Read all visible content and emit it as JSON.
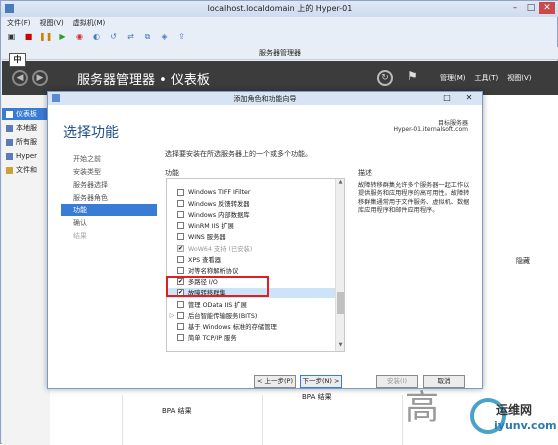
{
  "vm": {
    "title": "localhost.localdomain 上的 Hyper-01",
    "menu": [
      "文件(F)",
      "视图(V)",
      "虚拟机(M)"
    ]
  },
  "server_manager": {
    "window_title": "服务器管理器",
    "ime_indicator": "中",
    "breadcrumb": "服务器管理器 • 仪表板",
    "menu": [
      "管理(M)",
      "工具(T)",
      "视图(V)"
    ],
    "nav": [
      "仪表板",
      "本地服",
      "所有服",
      "Hyper",
      "文件和"
    ],
    "bpa_results_1": "BPA 结果",
    "bpa_results_2": "BPA 结果",
    "hide_label": "隐藏"
  },
  "wizard": {
    "title": "添加角色和功能向导",
    "heading": "选择功能",
    "destination_label": "目标服务器",
    "destination_server": "Hyper-01.iternalsoft.com",
    "instruction": "选择要安装在所选服务器上的一个或多个功能。",
    "features_header": "功能",
    "description_header": "描述",
    "description": "故障转移群集允许多个服务器一起工作以提供服务和应用程序的高可用性。故障转移群集通常用于文件服务、虚拟机、数据库应用程序和邮件应用程序。",
    "steps": [
      {
        "label": "开始之前",
        "state": "normal"
      },
      {
        "label": "安装类型",
        "state": "normal"
      },
      {
        "label": "服务器选择",
        "state": "normal"
      },
      {
        "label": "服务器角色",
        "state": "normal"
      },
      {
        "label": "功能",
        "state": "active"
      },
      {
        "label": "确认",
        "state": "normal"
      },
      {
        "label": "结果",
        "state": "disabled"
      }
    ],
    "features": [
      {
        "label": "Windows TIFF IFilter",
        "checked": false,
        "expandable": false,
        "disabled": false
      },
      {
        "label": "Windows 反馈转发器",
        "checked": false,
        "expandable": false,
        "disabled": false
      },
      {
        "label": "Windows 内部数据库",
        "checked": false,
        "expandable": false,
        "disabled": false
      },
      {
        "label": "WinRM IIS 扩展",
        "checked": false,
        "expandable": false,
        "disabled": false
      },
      {
        "label": "WINS 服务器",
        "checked": false,
        "expandable": false,
        "disabled": false
      },
      {
        "label": "WoW64 支持 (已安装)",
        "checked": true,
        "expandable": false,
        "disabled": true
      },
      {
        "label": "XPS 查看器",
        "checked": false,
        "expandable": false,
        "disabled": false
      },
      {
        "label": "对等名称解析协议",
        "checked": false,
        "expandable": false,
        "disabled": false
      },
      {
        "label": "多路径 I/O",
        "checked": true,
        "expandable": false,
        "disabled": false
      },
      {
        "label": "故障转移群集",
        "checked": true,
        "expandable": false,
        "disabled": false,
        "selected": true
      },
      {
        "label": "管理 OData IIS 扩展",
        "checked": false,
        "expandable": false,
        "disabled": false
      },
      {
        "label": "后台智能传输服务(BITS)",
        "checked": false,
        "expandable": true,
        "disabled": false
      },
      {
        "label": "基于 Windows 标准的存储管理",
        "checked": false,
        "expandable": false,
        "disabled": false
      },
      {
        "label": "简单 TCP/IP 服务",
        "checked": false,
        "expandable": false,
        "disabled": false
      }
    ],
    "buttons": {
      "prev": "< 上一步(P)",
      "next": "下一步(N) >",
      "install": "安装(I)",
      "cancel": "取消"
    }
  },
  "watermark": {
    "chars": "高",
    "brand": "运维网",
    "site": "iyunv.com"
  }
}
